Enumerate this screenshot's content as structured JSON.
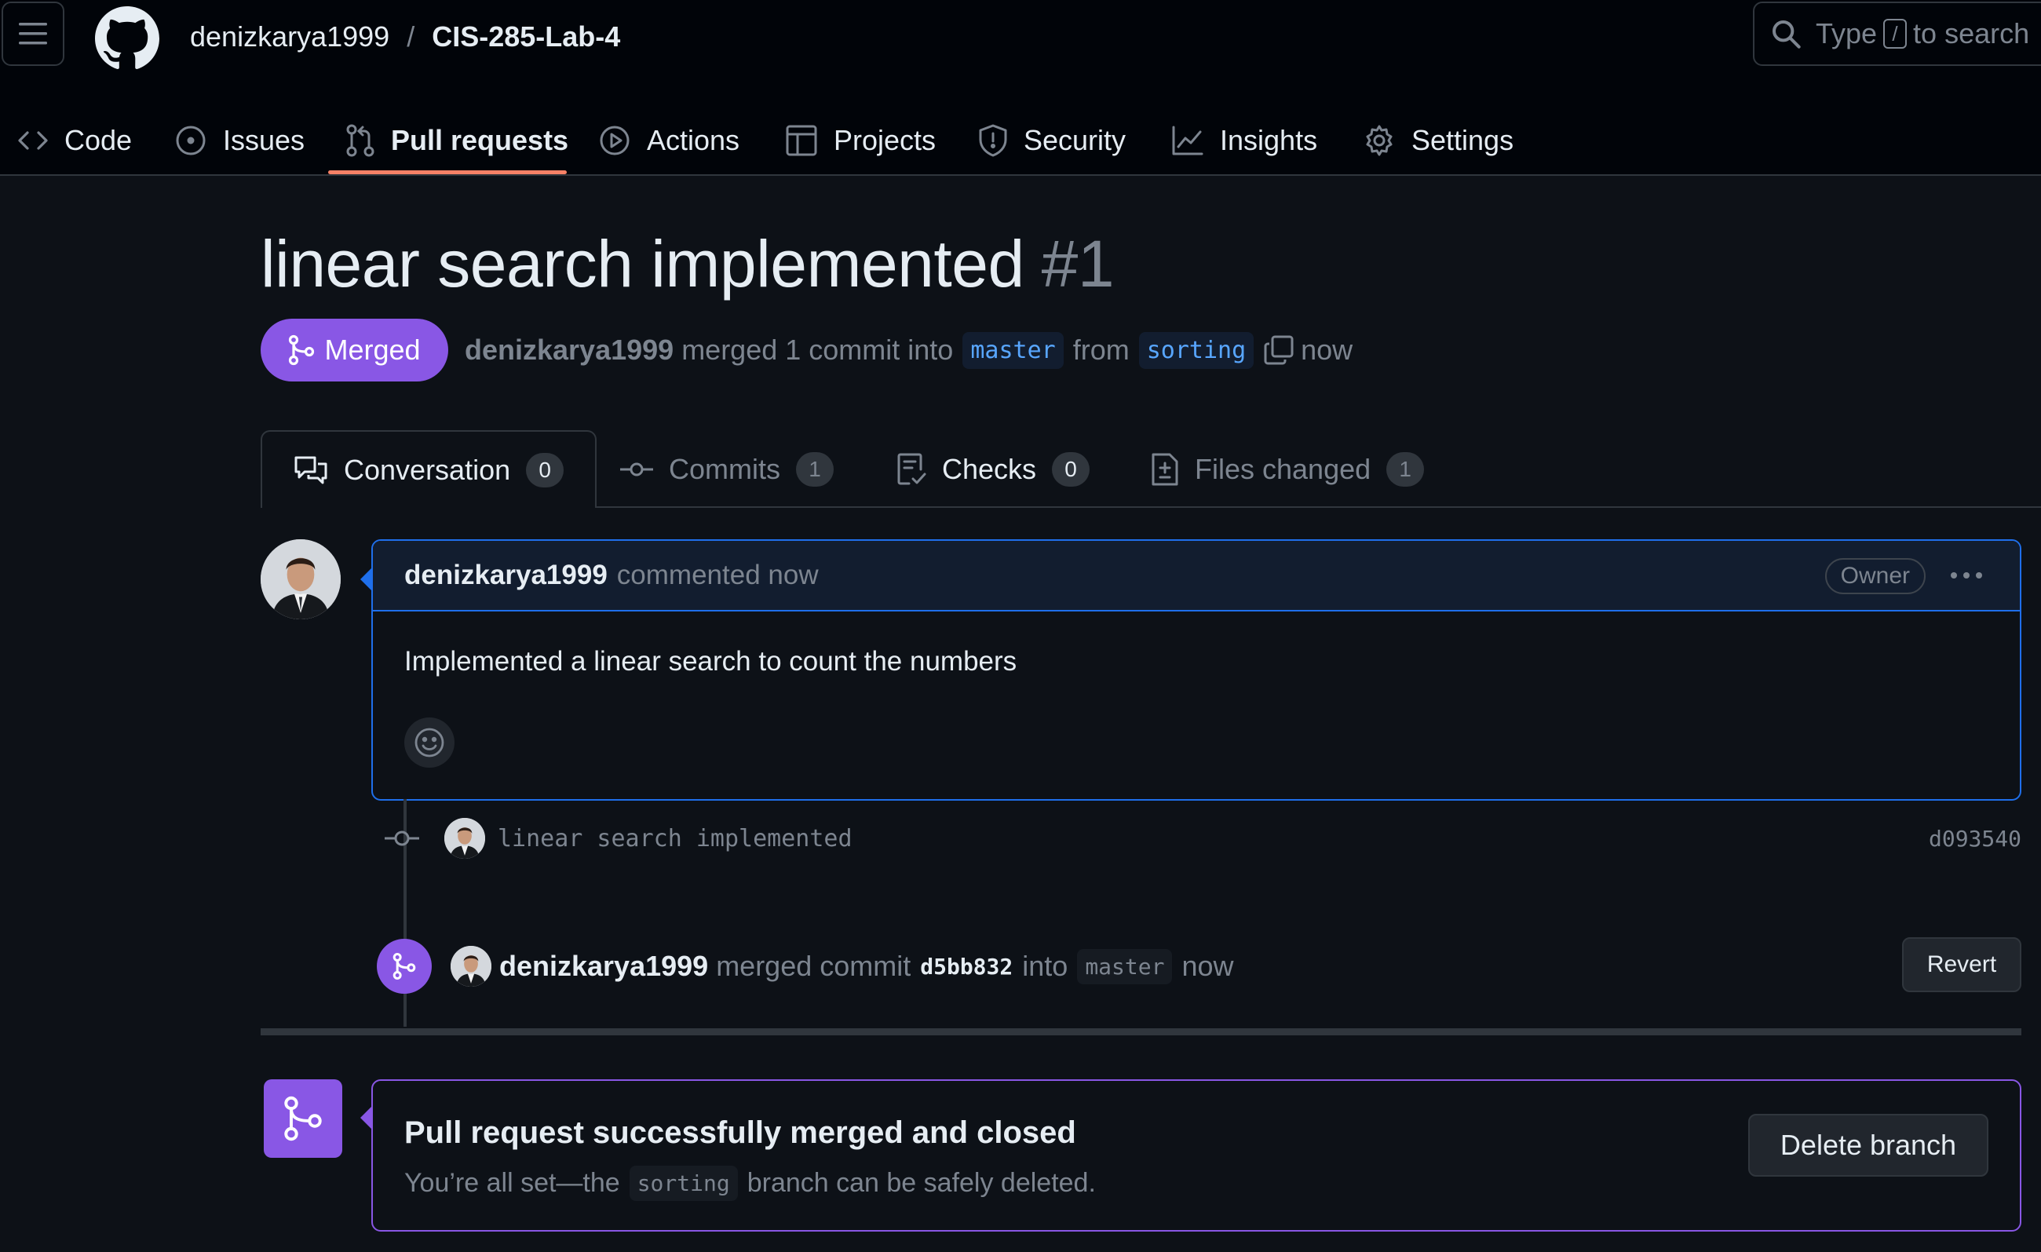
{
  "header": {
    "owner": "denizkarya1999",
    "separator": "/",
    "repo": "CIS-285-Lab-4",
    "search": {
      "prefix": "Type",
      "key": "/",
      "suffix": "to search"
    }
  },
  "nav": {
    "items": [
      {
        "label": "Code",
        "icon": "code-icon"
      },
      {
        "label": "Issues",
        "icon": "issue-icon"
      },
      {
        "label": "Pull requests",
        "icon": "pull-request-icon"
      },
      {
        "label": "Actions",
        "icon": "play-icon"
      },
      {
        "label": "Projects",
        "icon": "table-icon"
      },
      {
        "label": "Security",
        "icon": "shield-icon"
      },
      {
        "label": "Insights",
        "icon": "graph-icon"
      },
      {
        "label": "Settings",
        "icon": "gear-icon"
      }
    ],
    "active": "Pull requests"
  },
  "pr": {
    "title": "linear search implemented",
    "number": "#1",
    "state": "Merged",
    "meta": {
      "author": "denizkarya1999",
      "action": "merged 1 commit into",
      "base": "master",
      "from": "from",
      "head": "sorting",
      "time": "now"
    }
  },
  "tabs": [
    {
      "label": "Conversation",
      "count": "0"
    },
    {
      "label": "Commits",
      "count": "1"
    },
    {
      "label": "Checks",
      "count": "0"
    },
    {
      "label": "Files changed",
      "count": "1"
    }
  ],
  "comment": {
    "author": "denizkarya1999",
    "action": "commented now",
    "badge": "Owner",
    "body": "Implemented a linear search to count the numbers"
  },
  "commit": {
    "message": "linear search implemented",
    "sha": "d093540"
  },
  "merge_event": {
    "author": "denizkarya1999",
    "action": "merged commit",
    "sha": "d5bb832",
    "into": "into",
    "branch": "master",
    "time": "now",
    "revert_label": "Revert"
  },
  "merge_box": {
    "title": "Pull request successfully merged and closed",
    "sub_prefix": "You’re all set—the",
    "branch": "sorting",
    "sub_suffix": "branch can be safely deleted.",
    "delete_label": "Delete branch"
  },
  "colors": {
    "background": "#0d1117",
    "header": "#010409",
    "merged": "#8957e5",
    "accent_blue": "#1f6feb",
    "nav_underline": "#f78166"
  }
}
